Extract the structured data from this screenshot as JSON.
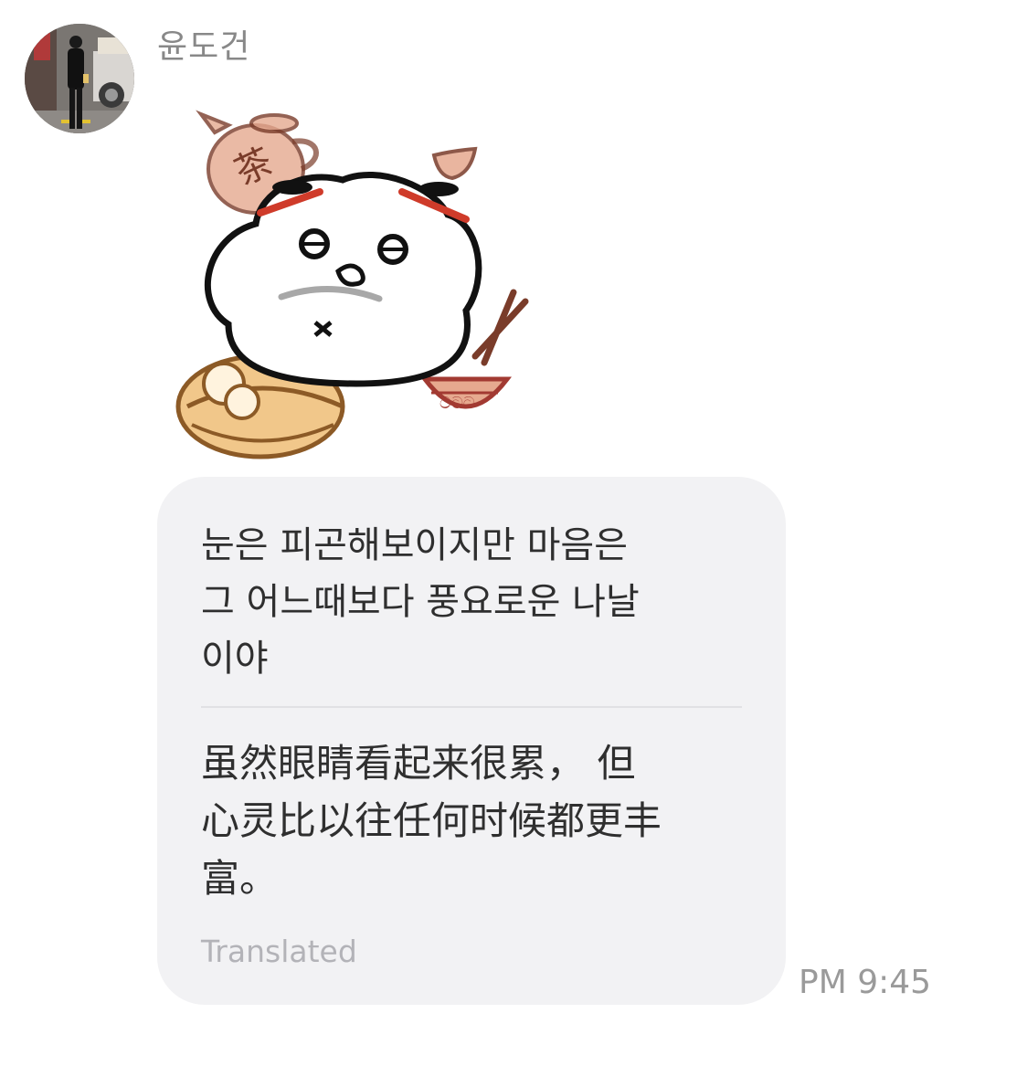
{
  "sender": {
    "name": "윤도건",
    "avatar_icon": "profile-photo"
  },
  "sticker": {
    "icon": "dumpling-bun-character-sticker"
  },
  "message": {
    "original_text": "눈은 피곤해보이지만 마음은\n그 어느때보다 풍요로운 나날\n이야",
    "translated_text": "虽然眼睛看起来很累， 但\n心灵比以往任何时候都更丰\n富。",
    "translated_label": "Translated",
    "time": "PM 9:45"
  },
  "colors": {
    "bubble_bg": "#f2f2f4",
    "text": "#2f2f2f",
    "muted": "#9a9a9a"
  }
}
